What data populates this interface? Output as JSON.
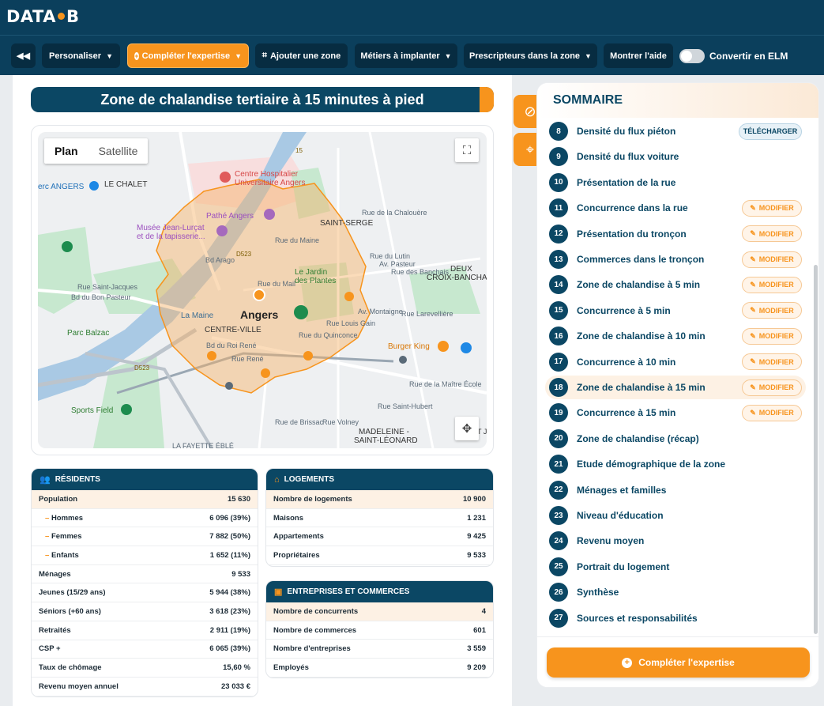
{
  "header": {
    "logo_left": "DATA",
    "logo_right": "B"
  },
  "toolbar": {
    "collapse_icon": "double-chevron-left-icon",
    "personaliser": "Personaliser",
    "completer": "Compléter l'expertise",
    "ajouter_zone": "Ajouter une zone",
    "metiers": "Métiers à implanter",
    "prescripteurs": "Prescripteurs dans la zone",
    "aide": "Montrer l'aide",
    "convertir": "Convertir en ELM"
  },
  "main": {
    "title": "Zone de chalandise tertiaire à 15 minutes à pied",
    "map": {
      "tab_plan": "Plan",
      "tab_satellite": "Satellite",
      "labels": {
        "centre_hosp_1": "Centre Hospitalier",
        "centre_hosp_2": "Universitaire Angers",
        "pathe": "Pathé Angers",
        "musee_1": "Musée Jean-Lurçat",
        "musee_2": "et de la tapisserie...",
        "le_chalet": "LE CHALET",
        "erc_angers": "erc ANGERS",
        "saint_serge": "SAINT-SERGE",
        "jardin_1": "Le Jardin",
        "jardin_2": "des Plantes",
        "angers": "Angers",
        "centre_ville": "CENTRE-VILLE",
        "parc_balzac": "Parc Balzac",
        "burger_king": "Burger King",
        "sports_field": "Sports Field",
        "madeleine_1": "MADELEINE -",
        "madeleine_2": "SAINT-LÉONARD",
        "croix_1": "CROIX-BANCHA",
        "deux_1": "DEUX",
        "la_maine": "La Maine",
        "d523": "D523",
        "d523b": "D523",
        "r15": "15",
        "rue_st_jacques": "Rue Saint-Jacques",
        "bd_bon_pasteur": "Bd du Bon Pasteur",
        "rue_larevelliere": "Rue Larevellière",
        "rue_louis_gain": "Rue Louis Gain",
        "rue_quinconce": "Rue du Quinconce",
        "bd_roi_rene": "Bd du Roi René",
        "rue_mail": "Rue du Mail",
        "rue_maine": "Rue du Maine",
        "bd_arago": "Bd Arago",
        "av_montaigne": "Av. Montaigne",
        "rue_lutin": "Rue du Lutin",
        "av_pasteur": "Av. Pasteur",
        "rue_banchais": "Rue des Banchais",
        "rue_st_hubert": "Rue Saint-Hubert",
        "rue_maitre_ecole": "Rue de la Maître École",
        "rue_volney": "Rue Volney",
        "rue_brissac": "Rue de Brissac",
        "rue_chaloutre": "Rue de la Chalouère",
        "la_fayette": "LA FAYETTE ÉBLÉ",
        "saint_jo": "SAINT JO",
        "rene": "Rue René"
      }
    },
    "residents": {
      "title": "Résidents",
      "rows": [
        {
          "label": "Population",
          "value": "15 630"
        },
        {
          "label": "Hommes",
          "value": "6 096 (39%)"
        },
        {
          "label": "Femmes",
          "value": "7 882 (50%)"
        },
        {
          "label": "Enfants",
          "value": "1 652 (11%)"
        },
        {
          "label": "Ménages",
          "value": "9 533"
        },
        {
          "label": "Jeunes (15/29 ans)",
          "value": "5 944 (38%)"
        },
        {
          "label": "Séniors (+60 ans)",
          "value": "3 618 (23%)"
        },
        {
          "label": "Retraités",
          "value": "2 911 (19%)"
        },
        {
          "label": "CSP +",
          "value": "6 065 (39%)"
        },
        {
          "label": "Taux de chômage",
          "value": "15,60 %"
        },
        {
          "label": "Revenu moyen annuel",
          "value": "23 033 €"
        }
      ]
    },
    "logements": {
      "title": "Logements",
      "rows": [
        {
          "label": "Nombre de logements",
          "value": "10 900"
        },
        {
          "label": "Maisons",
          "value": "1 231"
        },
        {
          "label": "Appartements",
          "value": "9 425"
        },
        {
          "label": "Propriétaires",
          "value": "9 533"
        }
      ]
    },
    "entreprises": {
      "title": "Entreprises et commerces",
      "rows": [
        {
          "label": "Nombre de concurrents",
          "value": "4"
        },
        {
          "label": "Nombre de commerces",
          "value": "601"
        },
        {
          "label": "Nombre d'entreprises",
          "value": "3 559"
        },
        {
          "label": "Employés",
          "value": "9 209"
        }
      ]
    }
  },
  "sommaire": {
    "title": "SOMMAIRE",
    "telecharger": "TÉLÉCHARGER",
    "modifier": "MODIFIER",
    "items": [
      {
        "num": "8",
        "label": "Densité du flux piéton"
      },
      {
        "num": "9",
        "label": "Densité du flux voiture"
      },
      {
        "num": "10",
        "label": "Présentation de la rue"
      },
      {
        "num": "11",
        "label": "Concurrence dans la rue"
      },
      {
        "num": "12",
        "label": "Présentation du tronçon"
      },
      {
        "num": "13",
        "label": "Commerces dans le tronçon"
      },
      {
        "num": "14",
        "label": "Zone de chalandise à 5 min"
      },
      {
        "num": "15",
        "label": "Concurrence à 5 min"
      },
      {
        "num": "16",
        "label": "Zone de chalandise à 10 min"
      },
      {
        "num": "17",
        "label": "Concurrence à 10 min"
      },
      {
        "num": "18",
        "label": "Zone de chalandise à 15 min"
      },
      {
        "num": "19",
        "label": "Concurrence à 15 min"
      },
      {
        "num": "20",
        "label": "Zone de chalandise (récap)"
      },
      {
        "num": "21",
        "label": "Etude démographique de la zone"
      },
      {
        "num": "22",
        "label": "Ménages et familles"
      },
      {
        "num": "23",
        "label": "Niveau d'éducation"
      },
      {
        "num": "24",
        "label": "Revenu moyen"
      },
      {
        "num": "25",
        "label": "Portrait du logement"
      },
      {
        "num": "26",
        "label": "Synthèse"
      },
      {
        "num": "27",
        "label": "Sources et responsabilités"
      }
    ],
    "cta": "Compléter l'expertise"
  }
}
